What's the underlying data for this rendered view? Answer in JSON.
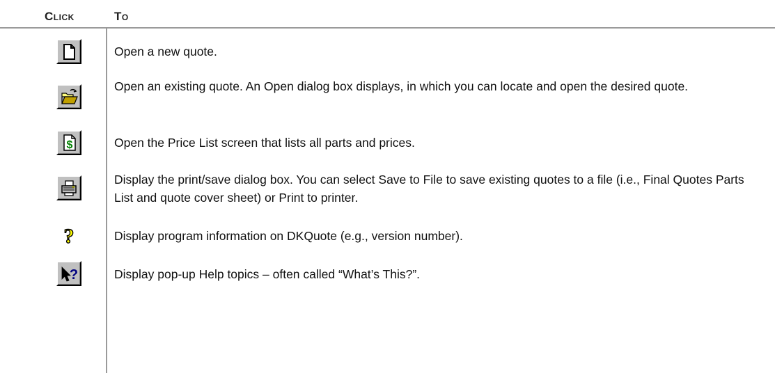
{
  "header": {
    "click": "Click",
    "to": "To"
  },
  "rows": [
    {
      "icon": "new-document-icon",
      "text": "Open a new quote."
    },
    {
      "icon": "open-folder-icon",
      "text": "Open an existing quote. An Open dialog box displays, in which you can locate and open the desired quote."
    },
    {
      "icon": "price-list-icon",
      "text": "Open the Price List screen that lists all parts and prices."
    },
    {
      "icon": "printer-icon",
      "text": "Display the print/save dialog box. You can select Save to File to save existing quotes to a file (i.e., Final Quotes Parts List and quote cover sheet) or Print to printer."
    },
    {
      "icon": "question-mark-icon",
      "text": "Display program information on DKQuote (e.g., version number)."
    },
    {
      "icon": "whats-this-icon",
      "text": "Display pop-up Help topics – often called “What’s This?”."
    }
  ],
  "colors": {
    "rule": "#9a9a9a",
    "button_face": "#c0c0c0",
    "dollar_green": "#008000",
    "question_yellow": "#ffff00"
  }
}
